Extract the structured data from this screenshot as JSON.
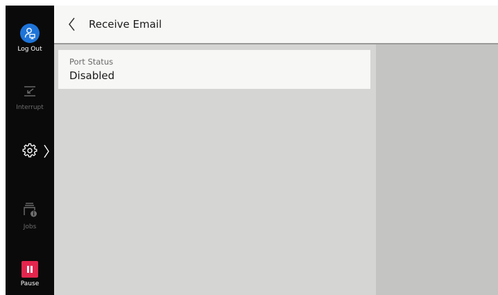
{
  "sidebar": {
    "logout_label": "Log Out",
    "interrupt_label": "Interrupt",
    "jobs_label": "Jobs",
    "pause_label": "Pause",
    "icons": [
      "user-device-icon",
      "interrupt-icon",
      "gear-icon",
      "chevron-right-icon",
      "jobs-info-icon",
      "pause-icon"
    ],
    "colors": {
      "logout_accent": "#1e74d8",
      "pause_accent": "#e3264d"
    }
  },
  "header": {
    "title": "Receive Email",
    "back_icon": "chevron-left-icon"
  },
  "main": {
    "items": [
      {
        "label": "Port Status",
        "value": "Disabled"
      }
    ]
  }
}
